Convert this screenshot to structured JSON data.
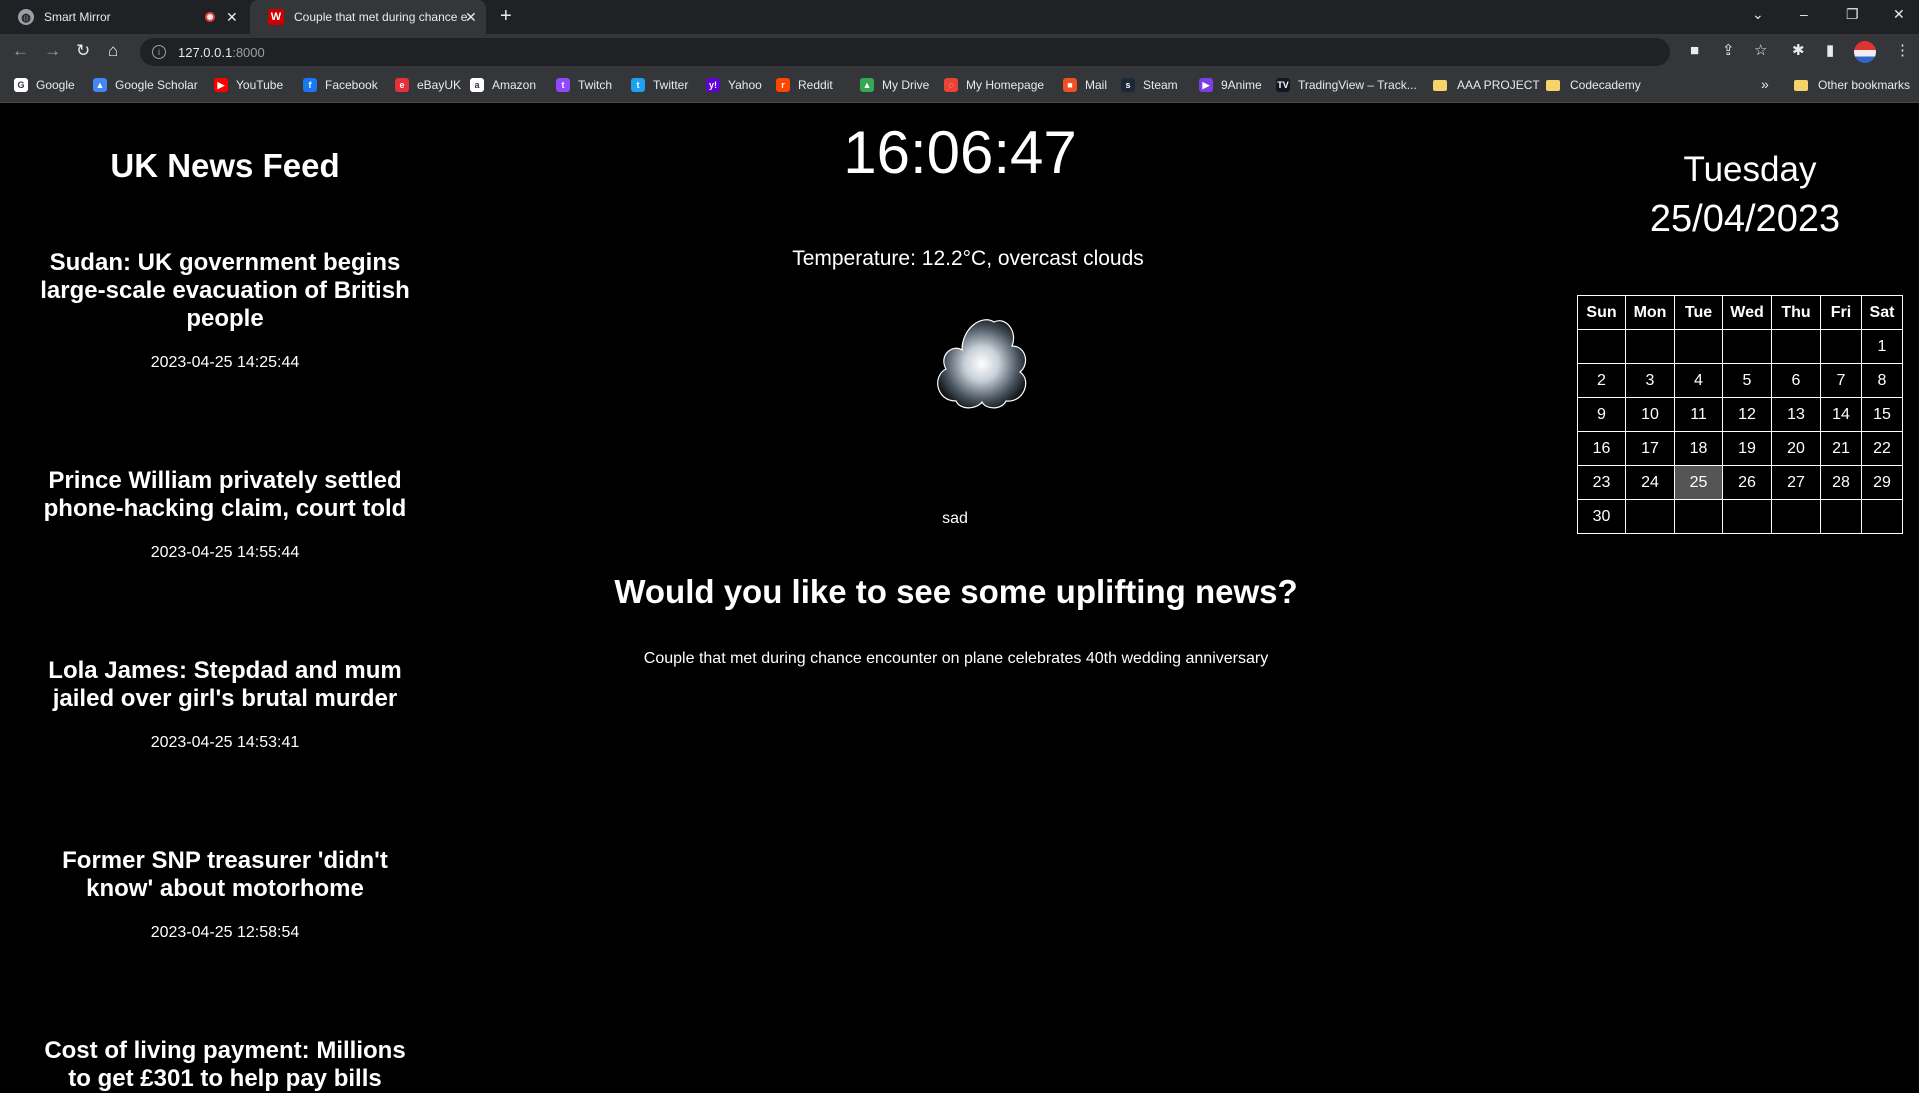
{
  "browser": {
    "tabs": [
      {
        "title": "Smart Mirror",
        "active": false
      },
      {
        "title": "Couple that met during chance e",
        "active": true
      }
    ],
    "new_tab": "+",
    "window_controls": [
      "⌄",
      "–",
      "❐",
      "✕"
    ],
    "url_host": "127.0.0.1",
    "url_port": ":8000",
    "bookmarks": [
      {
        "label": "Google",
        "icon": "google-icon",
        "color": "#ffffff",
        "glyph": "G"
      },
      {
        "label": "Google Scholar",
        "icon": "scholar-icon",
        "color": "#4285f4",
        "glyph": "▲"
      },
      {
        "label": "YouTube",
        "icon": "youtube-icon",
        "color": "#ff0000",
        "glyph": "▶"
      },
      {
        "label": "Facebook",
        "icon": "facebook-icon",
        "color": "#1877f2",
        "glyph": "f"
      },
      {
        "label": "eBayUK",
        "icon": "ebay-icon",
        "color": "#e53238",
        "glyph": "e"
      },
      {
        "label": "Amazon",
        "icon": "amazon-icon",
        "color": "#ffffff",
        "glyph": "a"
      },
      {
        "label": "Twitch",
        "icon": "twitch-icon",
        "color": "#9146ff",
        "glyph": "t"
      },
      {
        "label": "Twitter",
        "icon": "twitter-icon",
        "color": "#1da1f2",
        "glyph": "t"
      },
      {
        "label": "Yahoo",
        "icon": "yahoo-icon",
        "color": "#6001d2",
        "glyph": "y!"
      },
      {
        "label": "Reddit",
        "icon": "reddit-icon",
        "color": "#ff4500",
        "glyph": "r"
      },
      {
        "label": "My Drive",
        "icon": "drive-icon",
        "color": "#34a853",
        "glyph": "▲"
      },
      {
        "label": "My Homepage",
        "icon": "homepage-icon",
        "color": "#ea4335",
        "glyph": "◌"
      },
      {
        "label": "Mail",
        "icon": "mail-icon",
        "color": "#f25022",
        "glyph": "■"
      },
      {
        "label": "Steam",
        "icon": "steam-icon",
        "color": "#1b2838",
        "glyph": "s"
      },
      {
        "label": "9Anime",
        "icon": "9anime-icon",
        "color": "#7b3fe4",
        "glyph": "▶"
      },
      {
        "label": "TradingView – Track...",
        "icon": "tradingview-icon",
        "color": "#131722",
        "glyph": "TV"
      },
      {
        "label": "AAA PROJECT",
        "icon": "folder-icon",
        "color": "#f6d36b",
        "glyph": ""
      },
      {
        "label": "Codecademy",
        "icon": "folder-icon",
        "color": "#f6d36b",
        "glyph": ""
      }
    ],
    "bookmarks_overflow": "»",
    "other_bookmarks": "Other bookmarks"
  },
  "news": {
    "title": "UK News Feed",
    "articles": [
      {
        "headline": "Sudan: UK government begins large-scale evacuation of British people",
        "time": "2023-04-25 14:25:44"
      },
      {
        "headline": "Prince William privately settled phone-hacking claim, court told",
        "time": "2023-04-25 14:55:44"
      },
      {
        "headline": "Lola James: Stepdad and mum jailed over girl's brutal murder",
        "time": "2023-04-25 14:53:41"
      },
      {
        "headline": "Former SNP treasurer 'didn't know' about motorhome",
        "time": "2023-04-25 12:58:54"
      },
      {
        "headline": "Cost of living payment: Millions to get £301 to help pay bills",
        "time": ""
      }
    ]
  },
  "clock": "16:06:47",
  "weather": {
    "text": "Temperature: 12.2°C, overcast clouds",
    "icon": "cloud-icon"
  },
  "mood": "sad",
  "uplifting": {
    "question": "Would you like to see some uplifting news?",
    "link": "Couple that met during chance encounter on plane celebrates 40th wedding anniversary"
  },
  "date": {
    "day": "Tuesday",
    "date": "25/04/2023"
  },
  "calendar": {
    "headers": [
      "Sun",
      "Mon",
      "Tue",
      "Wed",
      "Thu",
      "Fri",
      "Sat"
    ],
    "weeks": [
      [
        "",
        "",
        "",
        "",
        "",
        "",
        "1"
      ],
      [
        "2",
        "3",
        "4",
        "5",
        "6",
        "7",
        "8"
      ],
      [
        "9",
        "10",
        "11",
        "12",
        "13",
        "14",
        "15"
      ],
      [
        "16",
        "17",
        "18",
        "19",
        "20",
        "21",
        "22"
      ],
      [
        "23",
        "24",
        "25",
        "26",
        "27",
        "28",
        "29"
      ],
      [
        "30",
        "",
        "",
        "",
        "",
        "",
        ""
      ]
    ],
    "today": "25"
  }
}
